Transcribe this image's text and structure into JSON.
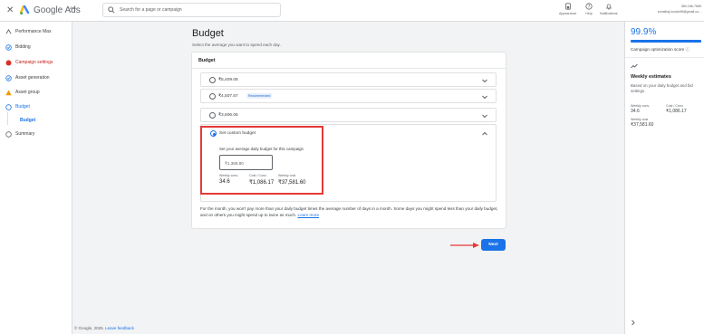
{
  "app": {
    "close_icon": "close-icon",
    "brand": "Google Ads",
    "brand_sub": "Ads"
  },
  "search": {
    "placeholder": "Search for a page or campaign"
  },
  "toolbar": {
    "appearance": "Appearance",
    "help": "Help",
    "notifications": "Notifications"
  },
  "account": {
    "id": "380-186-7685",
    "email": "sonaliraj.kundu98@gmail.co..."
  },
  "nav": {
    "items": [
      {
        "label": "Performance Max",
        "icon": "performance-icon"
      },
      {
        "label": "Bidding",
        "icon": "check-circle-icon"
      },
      {
        "label": "Campaign settings",
        "icon": "error-dot-icon"
      },
      {
        "label": "Asset generation",
        "icon": "check-circle-icon"
      },
      {
        "label": "Asset group",
        "icon": "warning-icon"
      },
      {
        "label": "Budget",
        "icon": "open-circle-icon"
      },
      {
        "label": "Summary",
        "icon": "open-circle-icon"
      }
    ],
    "sub_item": "Budget"
  },
  "main": {
    "title": "Budget",
    "subtitle": "Select the average you want to spend each day.",
    "card_title": "Budget",
    "options": [
      {
        "value": "₹5,409.08",
        "badge": ""
      },
      {
        "value": "₹4,507.57",
        "badge": "Recommended"
      },
      {
        "value": "₹3,606.06",
        "badge": ""
      }
    ],
    "custom": {
      "title": "Set custom budget",
      "description": "Set your average daily budget for this campaign",
      "amount": "₹1,368.80",
      "metrics": [
        {
          "label": "Weekly conv.",
          "value": "34.6"
        },
        {
          "label": "Cost / Conv.",
          "value": "₹1,086.17"
        },
        {
          "label": "Weekly cost",
          "value": "₹37,581.60"
        }
      ]
    },
    "note": "For the month, you won't pay more than your daily budget times the average number of days in a month. Some days you might spend less than your daily budget, and on others you might spend up to twice as much.",
    "note_link": "Learn more",
    "next_label": "Next"
  },
  "footer": {
    "copyright": "© Google, 2025.",
    "feedback": "Leave feedback"
  },
  "right_panel": {
    "score": "99.9%",
    "score_fraction": 0.999,
    "score_label": "Campaign optimization score",
    "info_icon": "ⓘ",
    "weekly_title": "Weekly estimates",
    "weekly_desc": "Based on your daily budget and bid settings",
    "stats": [
      {
        "label": "Weekly conv.",
        "value": "34.6"
      },
      {
        "label": "Cost / Conv.",
        "value": "₹1,086.17"
      },
      {
        "label": "Weekly cost",
        "value": "₹37,581.60"
      }
    ]
  },
  "colors": {
    "accent": "#1a73e8",
    "highlight": "#e53935",
    "warning": "#f29900",
    "error": "#d93025"
  }
}
